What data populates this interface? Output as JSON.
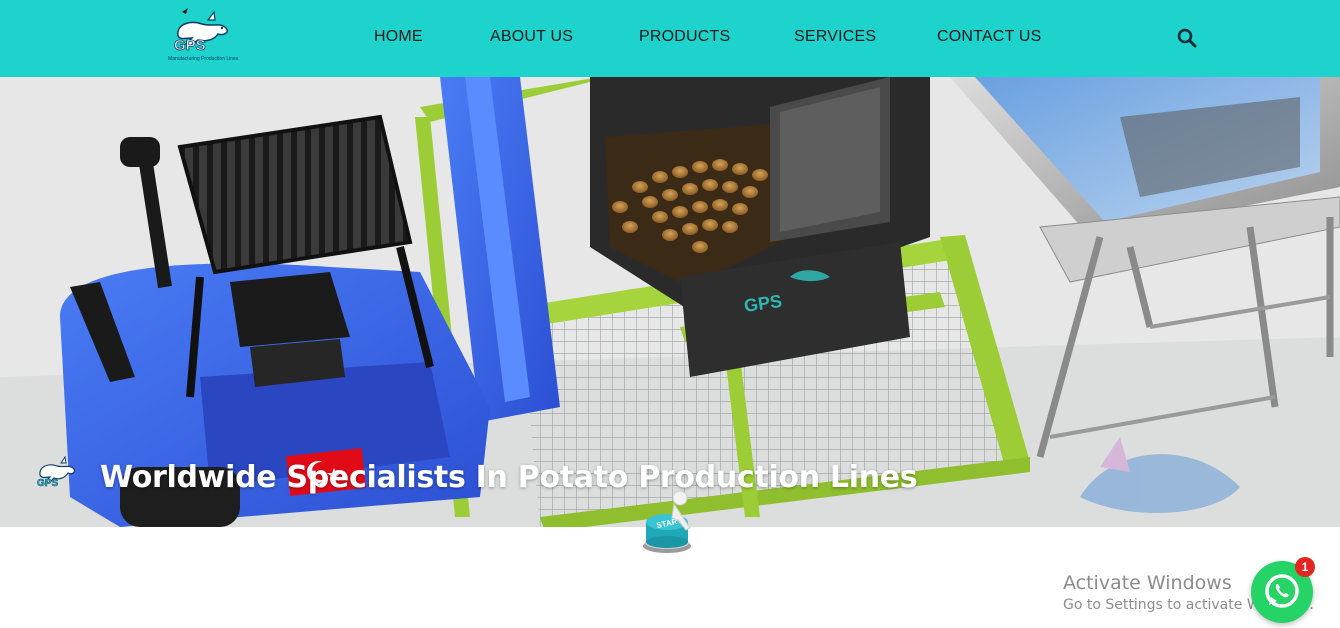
{
  "header": {
    "logo": {
      "brand": "GPS",
      "tagline": "Manufacturing Production Lines"
    },
    "nav": [
      {
        "label": "HOME"
      },
      {
        "label": "ABOUT US"
      },
      {
        "label": "PRODUCTS"
      },
      {
        "label": "SERVICES"
      },
      {
        "label": "CONTACT US"
      }
    ],
    "search_icon": "search-icon",
    "background_color": "#1dd3cc"
  },
  "hero": {
    "title": "Worldwide Specialists In Potato Production Lines",
    "flag": "turkey-flag",
    "button_text": "START"
  },
  "os_overlay": {
    "title": "Activate Windows",
    "subtitle": "Go to Settings to activate Windows."
  },
  "chat_widget": {
    "icon": "whatsapp-icon",
    "badge_count": "1",
    "color": "#25d366"
  }
}
